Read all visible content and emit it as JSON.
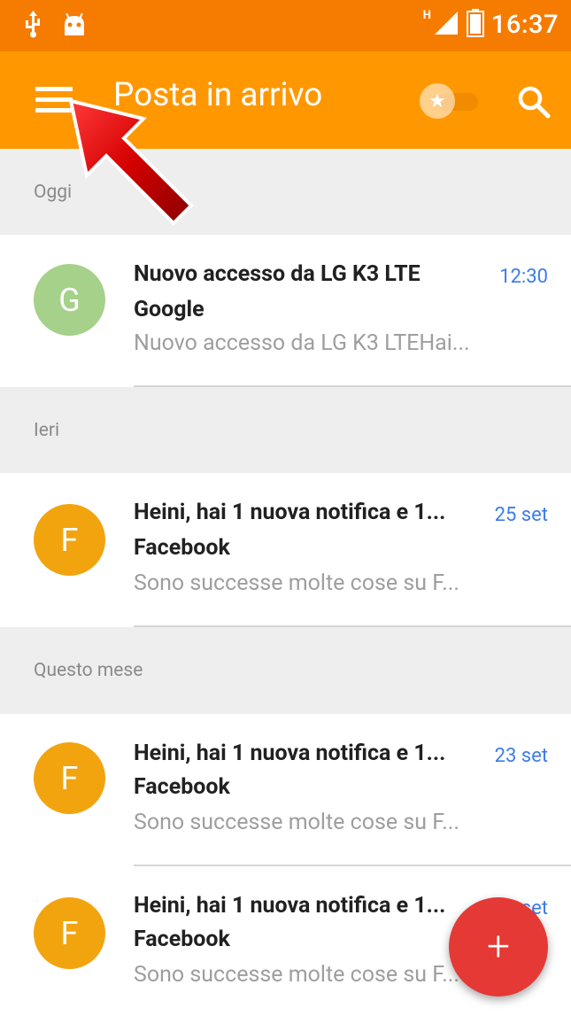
{
  "status_bar": {
    "time": "16:37",
    "network_label": "H",
    "icons": [
      "usb-icon",
      "android-icon",
      "signal-icon",
      "battery-icon"
    ]
  },
  "app_bar": {
    "title": "Posta in arrivo",
    "menu_icon": "menu-icon",
    "toggle_icon": "star-toggle",
    "search_icon": "search-icon"
  },
  "colors": {
    "status_bar": "#f57c00",
    "app_bar": "#ff9800",
    "fab": "#e53935",
    "date": "#3d7ce8",
    "avatar_g": "#a5d18a",
    "avatar_f": "#f2a40f"
  },
  "sections": [
    {
      "header": "Oggi",
      "emails": [
        {
          "avatar": "G",
          "subject": "Nuovo accesso da LG K3 LTE",
          "sender": "Google",
          "preview": "Nuovo accesso da LG K3 LTEHai...",
          "date": "12:30"
        }
      ]
    },
    {
      "header": "Ieri",
      "emails": [
        {
          "avatar": "F",
          "subject": "Heini, hai 1 nuova notifica e 1...",
          "sender": "Facebook",
          "preview": "Sono successe molte cose su F...",
          "date": "25 set"
        }
      ]
    },
    {
      "header": "Questo mese",
      "emails": [
        {
          "avatar": "F",
          "subject": "Heini, hai 1 nuova notifica e 1...",
          "sender": "Facebook",
          "preview": "Sono successe molte cose su F...",
          "date": "23 set"
        },
        {
          "avatar": "F",
          "subject": "Heini, hai 1 nuova notifica e 1...",
          "sender": "Facebook",
          "preview": "Sono successe molte cose su F...",
          "date": "set"
        }
      ]
    }
  ],
  "fab": {
    "label": "+"
  }
}
